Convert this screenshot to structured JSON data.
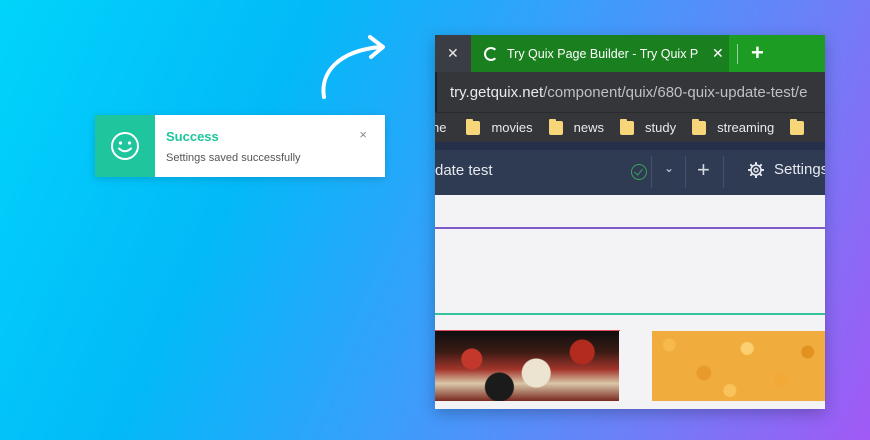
{
  "toast": {
    "title": "Success",
    "message": "Settings saved successfully",
    "close_glyph": "×",
    "icon": "smiley-icon",
    "accent": "#1fc59c"
  },
  "browser": {
    "tab_close_glyph": "✕",
    "active_tab": {
      "title": "Try Quix Page Builder - Try Quix P",
      "close_glyph": "✕"
    },
    "new_tab_glyph": "+",
    "address": {
      "host": "try.getquix.net",
      "path": "/component/quix/680-quix-update-test/e"
    },
    "bookmarks": [
      {
        "label": "ne",
        "folder": false
      },
      {
        "label": "movies",
        "folder": true
      },
      {
        "label": "news",
        "folder": true
      },
      {
        "label": "study",
        "folder": true
      },
      {
        "label": "streaming",
        "folder": true
      },
      {
        "label": "",
        "folder": true
      }
    ],
    "toolbar": {
      "title": "date test",
      "chevron": "⌄",
      "plus": "+",
      "settings_label": "Settings"
    },
    "colors": {
      "tabbar": "#1d9c24",
      "toolbar": "#2f3a53"
    }
  }
}
